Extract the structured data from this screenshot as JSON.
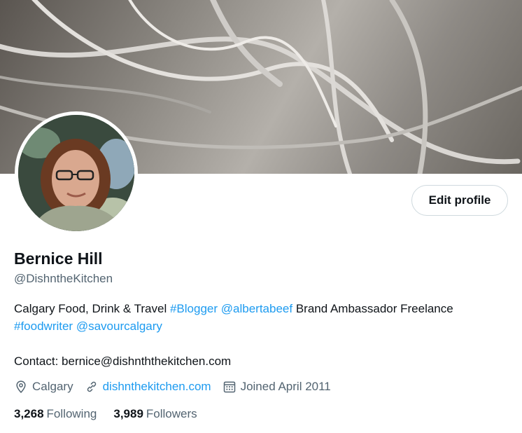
{
  "profile": {
    "name": "Bernice Hill",
    "handle": "@DishntheKitchen",
    "edit_label": "Edit profile",
    "bio": {
      "line1_text": "Calgary Food, Drink & Travel ",
      "line1_tag": "#Blogger",
      "line1_mention": "@albertabeef",
      "line1_rest": " Brand Ambassador Freelance",
      "line2_tag": "#foodwriter",
      "line2_mention": "@savourcalgary",
      "contact": "Contact: bernice@dishnththekitchen.com"
    },
    "location": "Calgary",
    "website": "dishnthekitchen.com",
    "joined": "Joined April 2011",
    "following_count": "3,268",
    "following_label": "Following",
    "followers_count": "3,989",
    "followers_label": "Followers"
  },
  "colors": {
    "accent": "#1d9bf0",
    "muted": "#536471",
    "text": "#0f1419"
  },
  "icons": [
    "location-icon",
    "link-icon",
    "calendar-icon"
  ]
}
